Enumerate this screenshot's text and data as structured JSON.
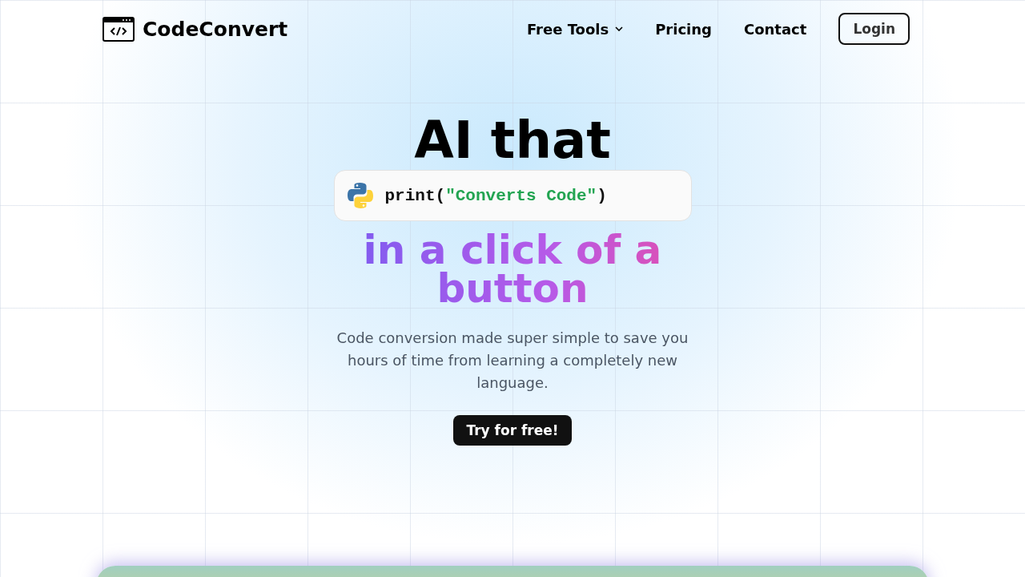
{
  "nav": {
    "brand": "CodeConvert",
    "links": [
      {
        "label": "Free Tools",
        "kind": "dropdown"
      },
      {
        "label": "Pricing",
        "kind": "link"
      },
      {
        "label": "Contact",
        "kind": "link"
      }
    ],
    "login": "Login"
  },
  "hero": {
    "title": "AI that",
    "code": [
      {
        "text": "print(",
        "kind": "plain"
      },
      {
        "text": "\"Converts Code\"",
        "kind": "string"
      },
      {
        "text": ")",
        "kind": "plain"
      }
    ],
    "subtitle": "in a click of a button",
    "description": "Code conversion made super simple to save you hours of time from learning a completely new language.",
    "cta": "Try for free!"
  }
}
